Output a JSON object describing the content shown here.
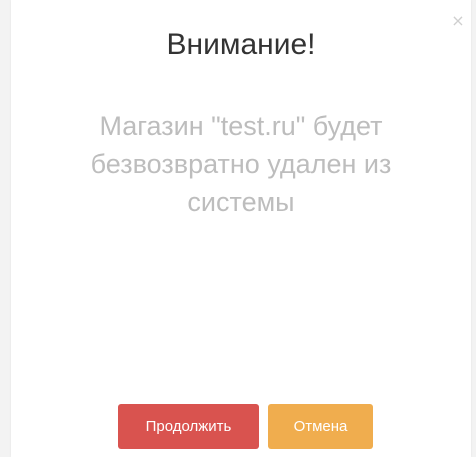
{
  "dialog": {
    "close_glyph": "×",
    "title": "Внимание!",
    "message": "Магазин \"test.ru\" будет безвозвратно удален из системы",
    "buttons": {
      "continue_label": "Продолжить",
      "cancel_label": "Отмена"
    }
  },
  "colors": {
    "continue_bg": "#d9534f",
    "cancel_bg": "#f0ad4e",
    "message_text": "#bdbdbd",
    "title_text": "#333333"
  },
  "icons": {
    "close": "close-icon"
  }
}
